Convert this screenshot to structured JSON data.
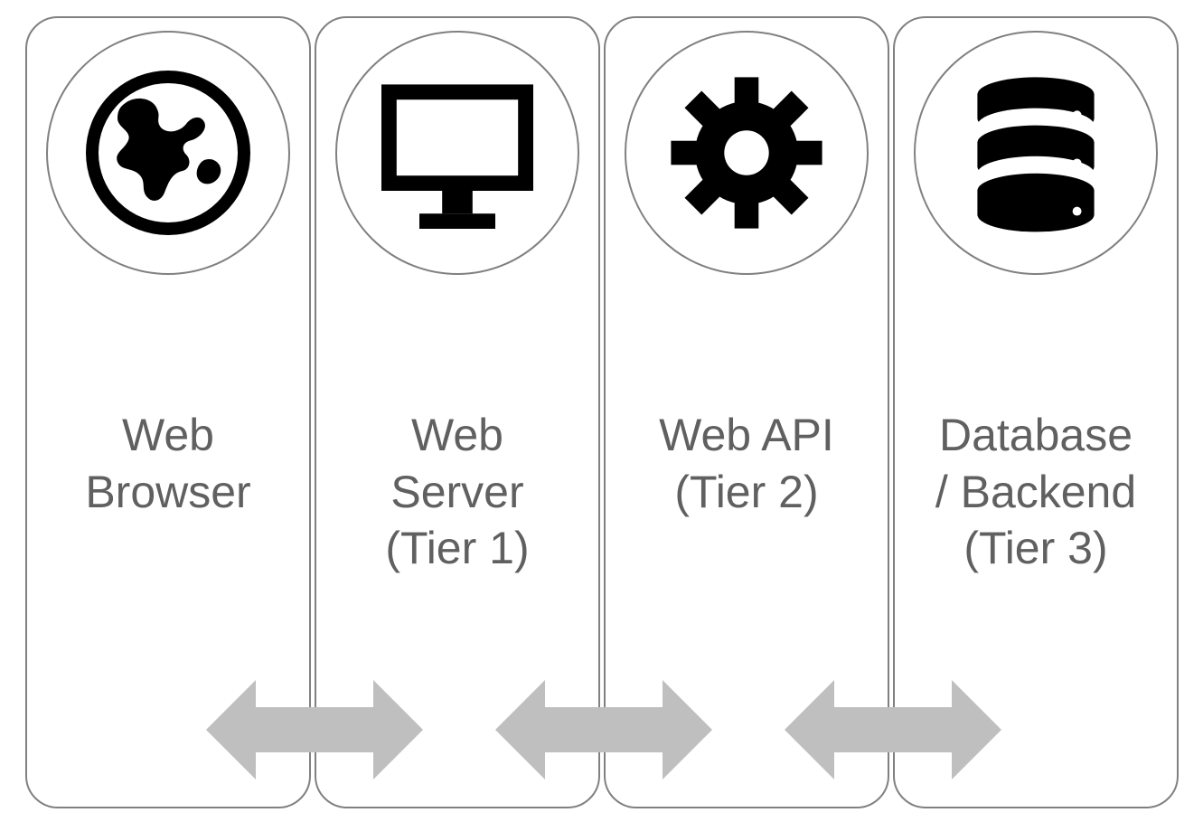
{
  "boxes": [
    {
      "id": "web-browser",
      "label": "Web\nBrowser",
      "icon": "globe-icon"
    },
    {
      "id": "web-server",
      "label": "Web\nServer\n(Tier 1)",
      "icon": "monitor-icon"
    },
    {
      "id": "web-api",
      "label": "Web API\n(Tier 2)",
      "icon": "gear-icon"
    },
    {
      "id": "database",
      "label": "Database\n/ Backend\n(Tier 3)",
      "icon": "database-icon"
    }
  ],
  "arrows": [
    {
      "id": "browser-to-server"
    },
    {
      "id": "server-to-api"
    },
    {
      "id": "api-to-database"
    }
  ],
  "colors": {
    "border": "#808080",
    "text": "#606060",
    "arrow": "#bfbfbf",
    "icon": "#000000"
  }
}
